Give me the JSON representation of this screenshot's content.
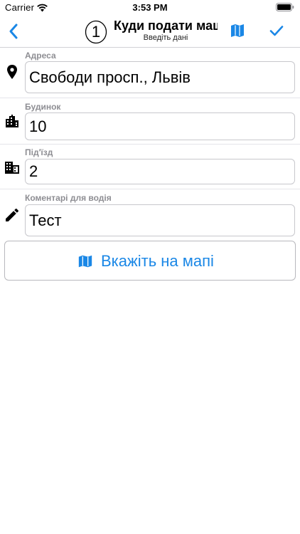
{
  "status_bar": {
    "carrier": "Carrier",
    "time": "3:53 PM"
  },
  "nav": {
    "step_number": "1",
    "title": "Куди подати машину",
    "subtitle": "Введіть дані",
    "back_icon": "chevron-left-icon",
    "map_icon": "map-icon",
    "confirm_icon": "checkmark-icon",
    "accent_color": "#1a87e6"
  },
  "form": {
    "address": {
      "label": "Адреса",
      "value": "Свободи просп., Львів",
      "icon": "location-pin-icon"
    },
    "building": {
      "label": "Будинок",
      "value": "10",
      "icon": "city-icon"
    },
    "entrance": {
      "label": "Під'їзд",
      "value": "2",
      "icon": "apartment-building-icon"
    },
    "comment": {
      "label": "Коментарі для водія",
      "value": "Тест",
      "icon": "pencil-icon"
    }
  },
  "map_button": {
    "label": "Вкажіть на мапі",
    "icon": "map-icon"
  }
}
